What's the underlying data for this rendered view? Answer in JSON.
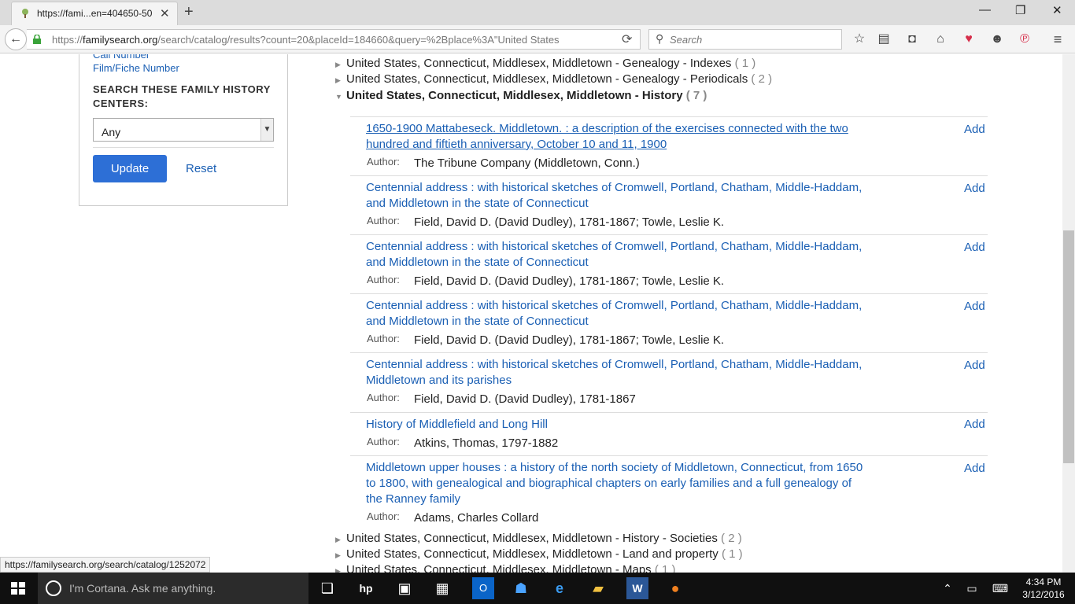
{
  "browser": {
    "tab_title": "https://fami...en=404650-50",
    "url_prefix": "https://",
    "url_host": "familysearch.org",
    "url_rest": "/search/catalog/results?count=20&placeId=184660&query=%2Bplace%3A\"United States",
    "search_placeholder": "Search",
    "status_url": "https://familysearch.org/search/catalog/1252072"
  },
  "sidebar": {
    "call_number_label": "Call Number",
    "film_fiche_label": "Film/Fiche Number",
    "centers_heading": "SEARCH THESE FAMILY HISTORY CENTERS:",
    "centers_select_value": "Any",
    "update_label": "Update",
    "reset_label": "Reset"
  },
  "tree": {
    "rows_top": [
      {
        "label": "United States, Connecticut, Middlesex, Middletown - Genealogy - Indexes",
        "count": "( 1 )"
      },
      {
        "label": "United States, Connecticut, Middlesex, Middletown - Genealogy - Periodicals",
        "count": "( 2 )"
      },
      {
        "label": "United States, Connecticut, Middlesex, Middletown - History",
        "count": "( 7 )"
      }
    ],
    "rows_bottom": [
      {
        "label": "United States, Connecticut, Middlesex, Middletown - History - Societies",
        "count": "( 2 )"
      },
      {
        "label": "United States, Connecticut, Middlesex, Middletown - Land and property",
        "count": "( 1 )"
      },
      {
        "label": "United States, Connecticut, Middlesex, Middletown - Maps",
        "count": "( 1 )"
      }
    ]
  },
  "results": {
    "author_label": "Author:",
    "add_label": "Add",
    "items": [
      {
        "title": "1650-1900 Mattabeseck. Middletown. : a description of the exercises connected with the two hundred and fiftieth anniversary, October 10 and 11, 1900",
        "author": "The Tribune Company (Middletown, Conn.)"
      },
      {
        "title": "Centennial address : with historical sketches of Cromwell, Portland, Chatham, Middle-Haddam, and Middletown in the state of Connecticut",
        "author": "Field, David D. (David Dudley), 1781-1867; Towle, Leslie K."
      },
      {
        "title": "Centennial address : with historical sketches of Cromwell, Portland, Chatham, Middle-Haddam, and Middletown in the state of Connecticut",
        "author": "Field, David D. (David Dudley), 1781-1867; Towle, Leslie K."
      },
      {
        "title": "Centennial address : with historical sketches of Cromwell, Portland, Chatham, Middle-Haddam, and Middletown in the state of Connecticut",
        "author": "Field, David D. (David Dudley), 1781-1867; Towle, Leslie K."
      },
      {
        "title": "Centennial address : with historical sketches of Cromwell, Portland, Chatham, Middle-Haddam, Middletown and its parishes",
        "author": "Field, David D. (David Dudley), 1781-1867"
      },
      {
        "title": "History of Middlefield and Long Hill",
        "author": "Atkins, Thomas, 1797-1882"
      },
      {
        "title": "Middletown upper houses : a history of the north society of Middletown, Connecticut, from 1650 to 1800, with genealogical and biographical chapters on early families and a full genealogy of the Ranney family",
        "author": "Adams, Charles Collard"
      }
    ]
  },
  "taskbar": {
    "cortana_text": "I'm Cortana. Ask me anything.",
    "time": "4:34 PM",
    "date": "3/12/2016"
  },
  "colors": {
    "link": "#1a5fb4",
    "update_button": "#2d6fd6"
  }
}
